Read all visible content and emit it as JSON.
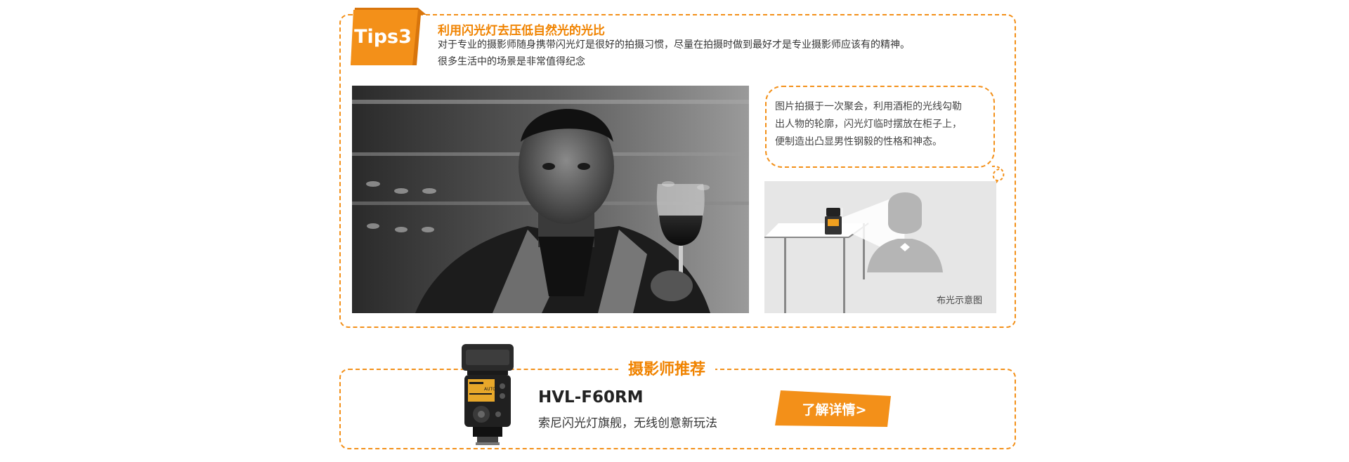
{
  "tips": {
    "badge": "Tips3",
    "title": "利用闪光灯去压低自然光的光比",
    "desc_line1": "对于专业的摄影师随身携带闪光灯是很好的拍摄习惯，尽量在拍摄时做到最好才是专业摄影师应该有的精神。",
    "desc_line2": "很多生活中的场景是非常值得纪念",
    "caption_line1": "图片拍摄于一次聚会，利用酒柜的光线勾勒",
    "caption_line2": "出人物的轮廓，闪光灯临时摆放在柜子上，",
    "caption_line3": "便制造出凸显男性钢毅的性格和神态。",
    "diagram_label": "布光示意图"
  },
  "recommend": {
    "heading": "摄影师推荐",
    "model": "HVL-F60RM",
    "tagline": "索尼闪光灯旗舰，无线创意新玩法",
    "button": "了解详情>",
    "flash_screen": "AUTO"
  },
  "colors": {
    "accent": "#f39019",
    "accent_dark": "#f08300"
  },
  "icons": [
    "tips-badge-icon",
    "flash-unit-icon",
    "person-silhouette-icon",
    "table-icon",
    "light-beam-icon"
  ]
}
